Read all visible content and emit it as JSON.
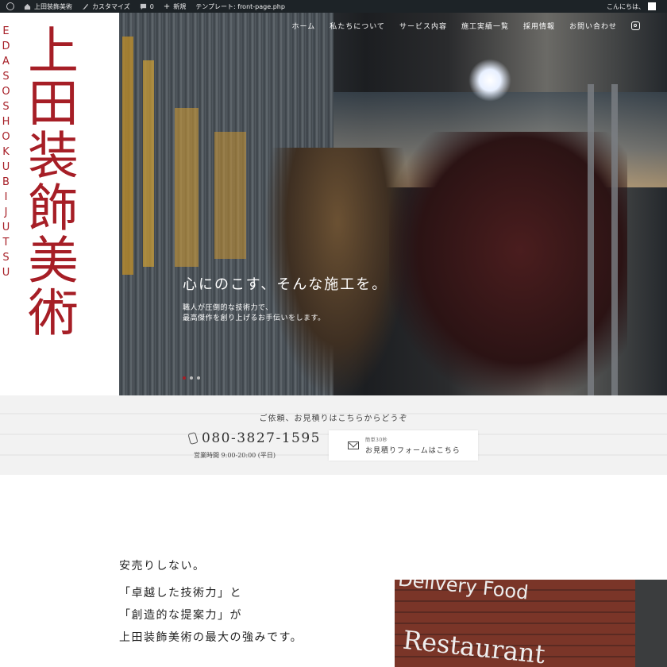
{
  "admin_bar": {
    "site_name": "上田装飾美術",
    "customize": "カスタマイズ",
    "comments": "0",
    "new": "新規",
    "template": "テンプレート: front-page.php",
    "greeting": "こんにちは、"
  },
  "brand": {
    "name_jp": "上田装飾美術",
    "name_en": "EDASOSHOKUBIJUTSU"
  },
  "nav": {
    "items": [
      "ホーム",
      "私たちについて",
      "サービス内容",
      "施工実績一覧",
      "採用情報",
      "お問い合わせ"
    ],
    "instagram_icon": "instagram-icon"
  },
  "hero": {
    "catch": "心にのこす、そんな施工を。",
    "sub_line1": "職人が圧倒的な技術力で、",
    "sub_line2": "最高傑作を創り上げるお手伝いをします。",
    "slide_count": 3,
    "active_slide": 1
  },
  "contact": {
    "lead": "ご依頼、お見積りはこちらからどうぞ",
    "phone": "080-3827-1595",
    "hours": "営業時間 9:00-20:00 (平日)",
    "form_small": "簡単30秒",
    "form_label": "お見積りフォームはこちら"
  },
  "intro": {
    "heading": "安売りしない。",
    "line1": "「卓越した技術力」と",
    "line2": "「創造的な提案力」が",
    "line3": "上田装飾美術の最大の強みです。"
  },
  "photo": {
    "sign_text1": "Delivery Food",
    "sign_text2": "Restaurant"
  },
  "colors": {
    "brand_red": "#a61e26",
    "admin_bar": "#1d2327"
  }
}
